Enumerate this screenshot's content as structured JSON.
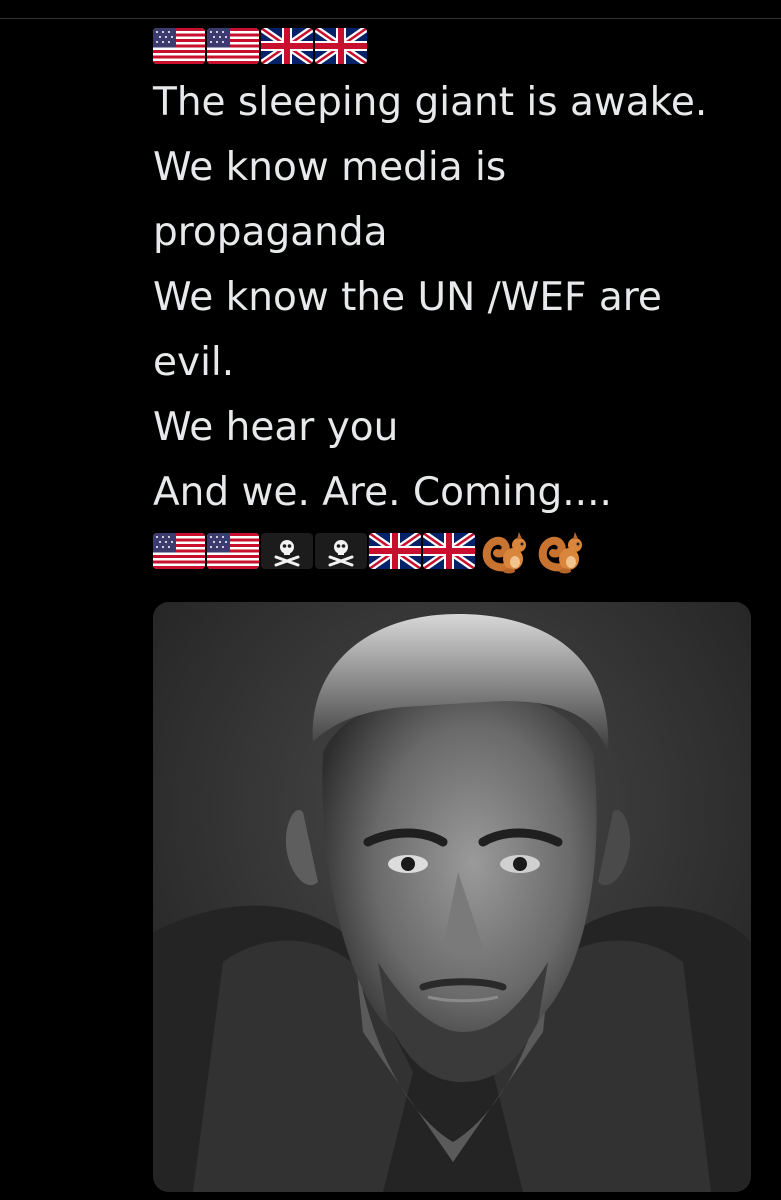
{
  "tweet": {
    "top_emojis": [
      {
        "icon": "us-flag-icon"
      },
      {
        "icon": "us-flag-icon"
      },
      {
        "icon": "uk-flag-icon"
      },
      {
        "icon": "uk-flag-icon"
      }
    ],
    "lines": [
      "The sleeping giant is awake.",
      "We know media is",
      "propaganda",
      "We know the UN /WEF are",
      "evil.",
      "We hear you",
      "And we. Are. Coming...."
    ],
    "bottom_emojis": [
      {
        "icon": "us-flag-icon"
      },
      {
        "icon": "us-flag-icon"
      },
      {
        "icon": "pirate-flag-icon"
      },
      {
        "icon": "pirate-flag-icon"
      },
      {
        "icon": "uk-flag-icon"
      },
      {
        "icon": "uk-flag-icon"
      },
      {
        "icon": "squirrel-icon"
      },
      {
        "icon": "squirrel-icon"
      }
    ],
    "media": {
      "kind": "photo",
      "icon": "portrait-photo"
    }
  },
  "colors": {
    "background": "#000000",
    "text": "#e7e9ea",
    "divider": "#2f3336"
  }
}
